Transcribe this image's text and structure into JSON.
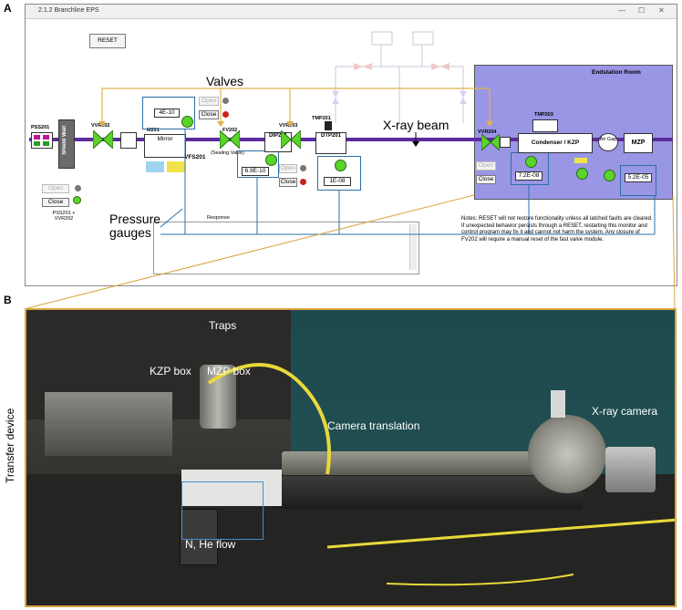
{
  "panel_labels": {
    "a": "A",
    "b": "B"
  },
  "window": {
    "title": "2.1.2 Branchline EPS",
    "controls": [
      "—",
      "☐",
      "✕"
    ]
  },
  "reset_button": "RESET",
  "annotations": {
    "valves": "Valves",
    "xray_beam": "X-ray beam",
    "pressure_gauges_line1": "Pressure",
    "pressure_gauges_line2": "gauges",
    "endstation_room": "Endstation Room"
  },
  "components": {
    "pss201": "PSS201",
    "shield_wall": "Shield Wall",
    "vvr202": "VVR202",
    "m201": "M201",
    "mirror": "Mirror",
    "fv202": "FV202",
    "sealing_valve": "(Sealing Valve)",
    "vfs201": "VFS201",
    "dip201": "DIP201",
    "vvr203": "VVR203",
    "tmp201": "TMP201",
    "dtp201": "DTP201",
    "vvr204": "VVR204",
    "tmp203": "TMP203",
    "condenser_kzp": "Condenser / KZP",
    "air_gap": "Air Gap",
    "mzp": "MZP",
    "pss_vvr_label": "PSS201 + VVR202",
    "response": "Response"
  },
  "buttons": {
    "open": "Open",
    "close": "Close"
  },
  "readouts": {
    "mirror_gauge": "4E-10",
    "fv202_gauge": "6.9E-10",
    "dtp201_gauge": "1E-08",
    "endstation_gauge": "7.2E-08",
    "mzp_gauge": "5.2E-05"
  },
  "notes": "Notes: RESET will not restore functionality unless all latched faults are cleared. If unexpected behavior persists through a RESET, restarting this monitor and control program may fix it and cannot not harm the system. Any closure of FV202 will require a manual reset of the fast valve module.",
  "photo_labels": {
    "transfer_device": "Transfer device",
    "traps": "Traps",
    "kzp_box": "KZP box",
    "mzp_box": "MZP box",
    "camera_translation": "Camera translation",
    "xray_camera": "X-ray camera",
    "n_he_flow": "N, He flow"
  },
  "colors": {
    "beamline": "#5b2c9e",
    "valve_green": "#5ad42a",
    "endstation": "#9a96e6",
    "gauge_blue": "#2a6fa8",
    "annotation_line": "#e2b24a",
    "photo_border": "#d9a53f"
  }
}
